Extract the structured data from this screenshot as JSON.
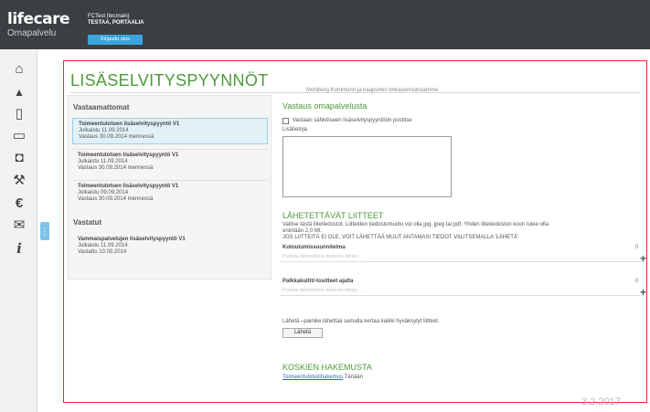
{
  "header": {
    "brand": "lifecare",
    "product": "Omapalvelu",
    "user_line1": "FCTest (tecmain)",
    "user_line2": "TESTAA, PORTAALIA",
    "logout_label": "Kirjaudu ulos"
  },
  "sidebar": {
    "items": [
      {
        "name": "home-icon",
        "glyph": "⌂"
      },
      {
        "name": "person-icon",
        "glyph": "▲"
      },
      {
        "name": "document-icon",
        "glyph": "▯"
      },
      {
        "name": "documents-icon",
        "glyph": "▭"
      },
      {
        "name": "inbox-icon",
        "glyph": "◘"
      },
      {
        "name": "tools-icon",
        "glyph": "⚒"
      },
      {
        "name": "euro-icon",
        "glyph": "€"
      },
      {
        "name": "mail-icon",
        "glyph": "✉"
      },
      {
        "name": "info-icon",
        "glyph": "i"
      }
    ],
    "handle_glyph": "⋮"
  },
  "page": {
    "title": "LISÄSELVITYSPYYNNÖT"
  },
  "unanswered": {
    "heading": "Vastaamattomat",
    "items": [
      {
        "title": "Toimeentulotuen lisäselvityspyyntö V1",
        "published": "Julkaistu 11.09.2014",
        "due": "Vastaus 30.09.2014 mennessä"
      },
      {
        "title": "Toimeentulotuen lisäselvityspyyntö V1",
        "published": "Julkaistu 11.09.2014",
        "due": "Vastaus 30.09.2014 mennessä"
      },
      {
        "title": "Toimeentulotuen lisäselvityspyyntö V1",
        "published": "Julkaistu 09.09.2014",
        "due": "Vastaus 30.09.2014 mennessä"
      }
    ]
  },
  "answered": {
    "heading": "Vastatut",
    "items": [
      {
        "title": "Vammaispalvelujen lisäselvityspyyntö V1",
        "published": "Julkaistu 11.09.2014",
        "answered": "Vastattu 10.09.2014"
      }
    ]
  },
  "reply": {
    "cut_text": "Mohiberg Kommunn ja naapurien toteasennuksiamme",
    "heading": "Vastaus omapalvelusta",
    "checkbox_label": "Vastaan sähköiseen lisäselvityspyyntöön postitse",
    "notes_label": "Lisätietoja"
  },
  "attachments": {
    "heading": "LÄHETETTÄVÄT LIITTEET",
    "help_line1": "Valitse tästä liitetiedostot. Liitteiden tiedostomuoto voi olla jpg, jpeg tai pdf. Yhden liitetiedoston koon tulee olla",
    "help_line2": "enintään 2,0 Mt.",
    "help_line3": "JOS LIITTEITÄ EI OLE, VOIT LÄHETTÄÄ MUUT ANTAMASI TIEDOT VALITSEMALLA 'LÄHETÄ'",
    "fields": [
      {
        "label": "Kotoutumissuunnitelma",
        "count": "0",
        "placeholder": "Pudota lähetettävä tiedosto tähän..."
      },
      {
        "label": "Palkkakuitit/-tositteet ajalta",
        "count": "0",
        "placeholder": "Pudota lähetettävä tiedosto tähän..."
      }
    ],
    "send_hint": "Lähetä –painike lähettää samalla kertaa kaikki hyväksytyt liitteet.",
    "send_label": "Lähetä"
  },
  "concerns": {
    "heading": "KOSKIEN HAKEMUSTA",
    "link": "Toimeentulotukihakemus",
    "date": "Tänään"
  },
  "date_stamp": "3.2.2017"
}
